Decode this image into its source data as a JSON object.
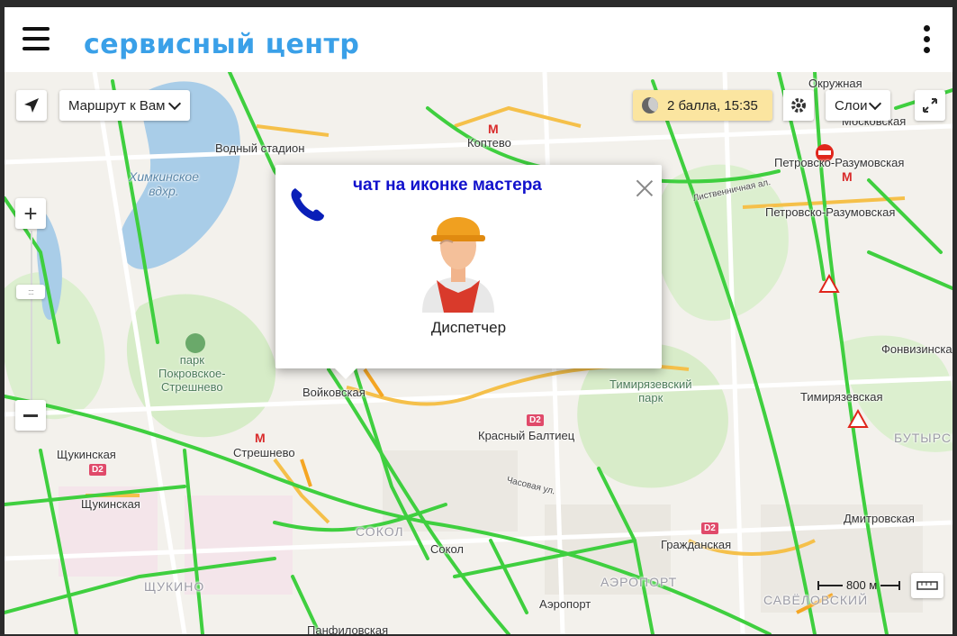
{
  "app": {
    "brand": "сервисный центр"
  },
  "map": {
    "route_button": "Маршрут к Вам",
    "traffic_label": "2 балла, 15:35",
    "layers_button": "Слои",
    "scale_label": "800 м",
    "labels": {
      "water_stadium": "Водный стадион",
      "koptevo": "Коптево",
      "okruzhnaya": "Окружная",
      "moskovskaya": "Московская",
      "petrovsko_razumovskaya_1": "Петровско-Разумовская",
      "petrovsko_razumovskaya_2": "Петровско-Разумовская",
      "listvennichnaya": "Лиственничная ал.",
      "khimki_reservoir": "Химкинское\nвдхр.",
      "park_pokrovskoe": "парк\nПокровское-\nСтрешнево",
      "voykovskaya": "Войковская",
      "timiryazevsky_park": "Тимирязевский\nпарк",
      "timiryazevskaya": "Тимирязевская",
      "fonvizinskaya": "Фонвизинская",
      "butyrsky": "БУТЫРСКИЙ",
      "krasny_baltiets": "Красный Балтиец",
      "schukinskaya": "Щукинская",
      "streshnevo": "Стрешнево",
      "schukinskaya2": "Щукинская",
      "sokol_district": "СОКОЛ",
      "sokol": "Сокол",
      "grazhdanskaya": "Гражданская",
      "dmitrovskaya": "Дмитровская",
      "aeroport_district": "АЭРОПОРТ",
      "aeroport": "Аэропорт",
      "savelovsky": "САВЁЛОВСКИЙ",
      "schukino": "ЩУКИНО",
      "panfilovskaya": "Панфиловская",
      "chasovaya": "Часовая ул.",
      "d2": "D2"
    },
    "popup": {
      "title": "чат на иконке мастера",
      "name": "Диспетчер"
    }
  },
  "colors": {
    "brand": "#3aa0e8",
    "road_green": "#3fcf3f",
    "road_yellow": "#f5c04a",
    "popup_title": "#1111cc",
    "phone_icon": "#0a1fb8"
  },
  "icons": [
    "menu-icon",
    "kebab-icon",
    "locate-icon",
    "chevron-down-icon",
    "gear-icon",
    "fullscreen-icon",
    "zoom-in-icon",
    "zoom-out-icon",
    "phone-icon",
    "close-icon",
    "ruler-icon",
    "worker-avatar"
  ]
}
